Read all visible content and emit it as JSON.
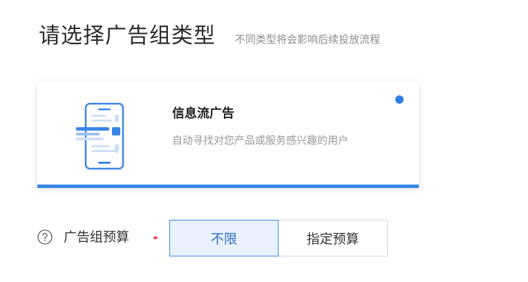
{
  "header": {
    "title": "请选择广告组类型",
    "subtitle": "不同类型将会影响后续投放流程"
  },
  "ad_type_card": {
    "title": "信息流广告",
    "description": "自动寻找对您产品或服务感兴趣的用户",
    "selected": true,
    "icon": "phone-feed-icon"
  },
  "budget": {
    "label": "广告组预算",
    "options": [
      "不限",
      "指定预算"
    ],
    "selected_option": "不限"
  },
  "colors": {
    "accent": "#3a86e8",
    "selected_bg": "#e8f1fd",
    "required": "#e8505b"
  }
}
